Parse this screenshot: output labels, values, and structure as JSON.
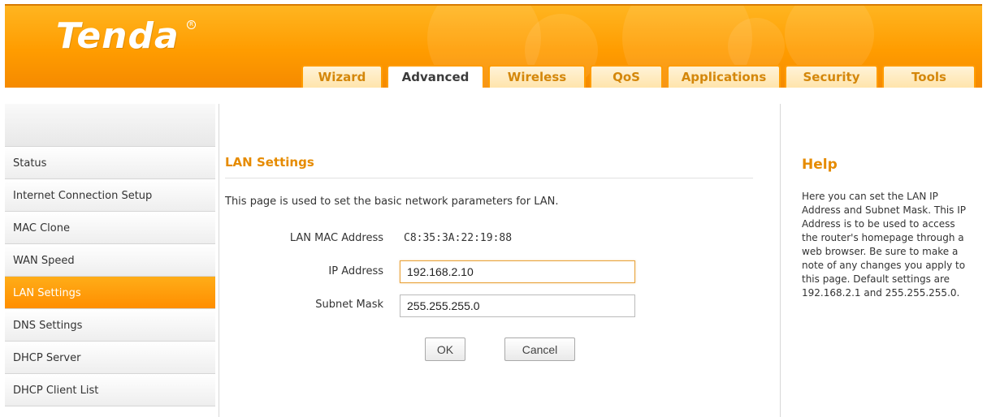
{
  "brand": {
    "logo": "Tenda",
    "registered": "R"
  },
  "tabs": [
    {
      "label": "Wizard",
      "active": false
    },
    {
      "label": "Advanced",
      "active": true
    },
    {
      "label": "Wireless",
      "active": false
    },
    {
      "label": "QoS",
      "active": false
    },
    {
      "label": "Applications",
      "active": false
    },
    {
      "label": "Security",
      "active": false
    },
    {
      "label": "Tools",
      "active": false
    }
  ],
  "sidebar": {
    "items": [
      {
        "label": "Status",
        "active": false
      },
      {
        "label": "Internet Connection Setup",
        "active": false
      },
      {
        "label": "MAC Clone",
        "active": false
      },
      {
        "label": "WAN Speed",
        "active": false
      },
      {
        "label": "LAN Settings",
        "active": true
      },
      {
        "label": "DNS Settings",
        "active": false
      },
      {
        "label": "DHCP Server",
        "active": false
      },
      {
        "label": "DHCP Client List",
        "active": false
      }
    ]
  },
  "main": {
    "title": "LAN Settings",
    "description": "This page is used to set the basic network parameters for LAN.",
    "mac": {
      "label": "LAN MAC Address",
      "value": "C8:35:3A:22:19:88"
    },
    "ip": {
      "label": "IP Address",
      "value": "192.168.2.10"
    },
    "mask": {
      "label": "Subnet Mask",
      "value": "255.255.255.0"
    },
    "ok_label": "OK",
    "cancel_label": "Cancel"
  },
  "help": {
    "title": "Help",
    "text": "Here you can set the LAN IP Address and Subnet Mask. This IP Address is to be used to access the router's homepage through a web browser. Be sure to make a note of any changes you apply to this page. Default settings are 192.168.2.1 and 255.255.255.0."
  },
  "colors": {
    "brand_orange": "#ff9c00",
    "title_orange": "#e68b00",
    "tab_text": "#d4870b",
    "active_menu": "#ff9c00"
  }
}
